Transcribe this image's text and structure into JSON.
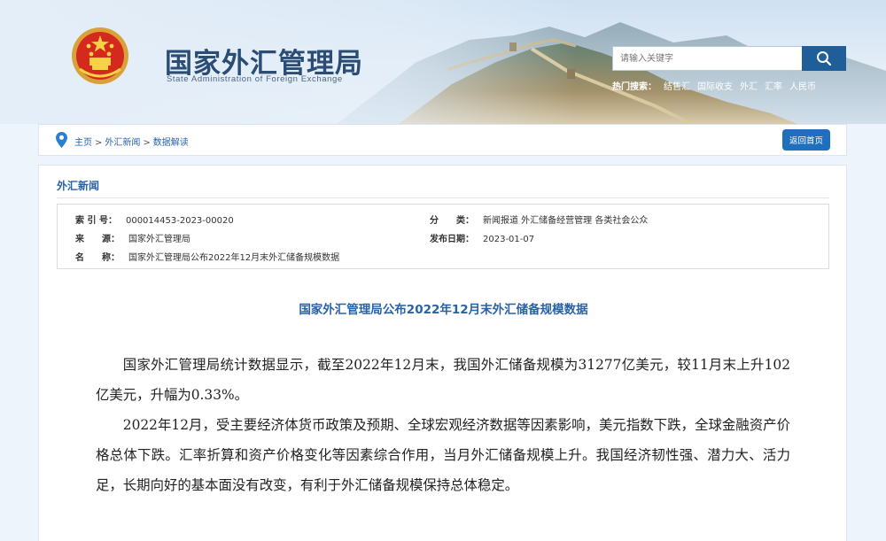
{
  "header": {
    "site_title": "国家外汇管理局",
    "site_subtitle": "State Administration of Foreign Exchange",
    "search": {
      "placeholder": "请输入关键字",
      "value": ""
    },
    "hot_search": {
      "label": "热门搜索：",
      "links": [
        "结售汇",
        "国际收支",
        "外汇",
        "汇率",
        "人民币"
      ]
    }
  },
  "breadcrumb": {
    "items": [
      "主页",
      "外汇新闻",
      "数据解读"
    ],
    "separator": ">"
  },
  "back_home_label": "返回首页",
  "section_title": "外汇新闻",
  "meta": {
    "index_label": "索 引 号：",
    "index_value": "000014453-2023-00020",
    "category_label": "分　　类：",
    "category_value": "新闻报道  外汇储备经营管理  各类社会公众",
    "source_label": "来　　源：",
    "source_value": "国家外汇管理局",
    "date_label": "发布日期：",
    "date_value": "2023-01-07",
    "name_label": "名　　称：",
    "name_value": "国家外汇管理局公布2022年12月末外汇储备规模数据"
  },
  "article": {
    "title": "国家外汇管理局公布2022年12月末外汇储备规模数据",
    "paragraphs": [
      "国家外汇管理局统计数据显示，截至2022年12月末，我国外汇储备规模为31277亿美元，较11月末上升102亿美元，升幅为0.33%。",
      "2022年12月，受主要经济体货币政策及预期、全球宏观经济数据等因素影响，美元指数下跌，全球金融资产价格总体下跌。汇率折算和资产价格变化等因素综合作用，当月外汇储备规模上升。我国经济韧性强、潜力大、活力足，长期向好的基本面没有改变，有利于外汇储备规模保持总体稳定。"
    ]
  },
  "colors": {
    "brand_blue": "#2a62a6",
    "search_button": "#1f5e99",
    "back_button": "#1f6fbf"
  },
  "icons": {
    "emblem": "national-emblem-icon",
    "search": "search-icon",
    "location": "location-pin-icon"
  }
}
